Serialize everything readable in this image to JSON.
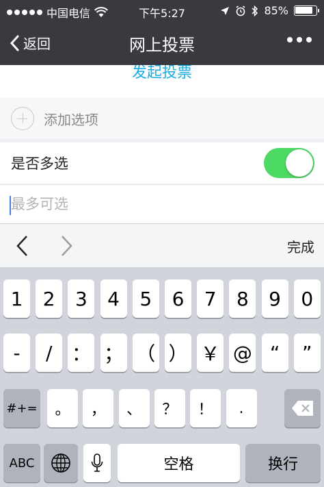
{
  "status_bar": {
    "carrier": "中国电信",
    "time": "下午5:27",
    "battery": "85%",
    "battery_level": 0.85
  },
  "nav": {
    "back_label": "返回",
    "title": "网上投票"
  },
  "form": {
    "start_vote": "发起投票",
    "add_option": "添加选项",
    "multi_select_label": "是否多选",
    "multi_select_on": true,
    "max_select_placeholder": "最多可选"
  },
  "accessory": {
    "done_label": "完成"
  },
  "keyboard": {
    "row1": [
      "1",
      "2",
      "3",
      "4",
      "5",
      "6",
      "7",
      "8",
      "9",
      "0"
    ],
    "row2": [
      "-",
      "/",
      "：",
      "；",
      "（",
      "）",
      "￥",
      "@",
      "“",
      "”"
    ],
    "row3_left": "#+=",
    "row3": [
      "。",
      "，",
      "、",
      "？",
      "！",
      "."
    ],
    "row4": {
      "abc": "ABC",
      "space": "空格",
      "return": "换行"
    }
  }
}
